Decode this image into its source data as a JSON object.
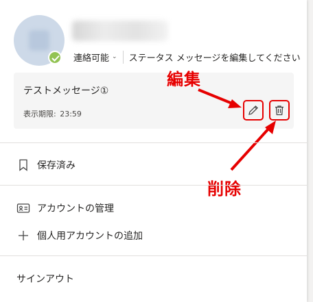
{
  "status": {
    "availability": "連絡可能",
    "dropdown_glyph": "⌄",
    "edit_status_message": "ステータス メッセージを編集してください"
  },
  "message_card": {
    "text": "テストメッセージ①",
    "expiry_label": "表示期限:",
    "expiry_time": "23:59"
  },
  "annotations": {
    "edit": "編集",
    "delete": "削除"
  },
  "menu": {
    "saved": "保存済み",
    "manage_account": "アカウントの管理",
    "add_personal_account": "個人用アカウントの追加",
    "sign_out": "サインアウト"
  },
  "colors": {
    "annotation_red": "#e60000",
    "presence_available": "#92c353"
  }
}
